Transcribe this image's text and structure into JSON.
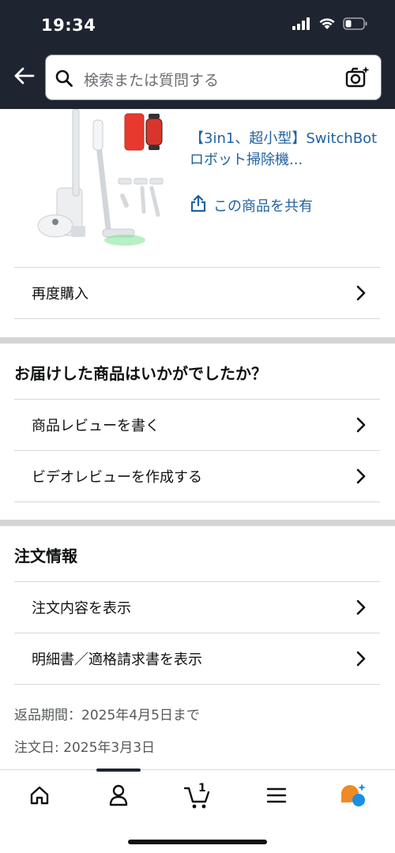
{
  "status_bar": {
    "time": "19:34"
  },
  "search": {
    "placeholder": "検索または質問する"
  },
  "product": {
    "title": "【3in1、超小型】SwitchBot ロボット掃除機...",
    "share_label": "この商品を共有"
  },
  "actions": {
    "buy_again": "再度購入"
  },
  "review_section": {
    "title": "お届けした商品はいかがでしたか？",
    "items": [
      {
        "label": "商品レビューを書く"
      },
      {
        "label": "ビデオレビューを作成する"
      }
    ]
  },
  "order_section": {
    "title": "注文情報",
    "items": [
      {
        "label": "注文内容を表示"
      },
      {
        "label": "明細書／適格請求書を表示"
      }
    ],
    "return_period": "返品期間：2025年4月5日まで",
    "order_date": "注文日: 2025年3月3日"
  },
  "bottom_nav": {
    "cart_count": "1",
    "items": [
      "home-icon",
      "account-icon",
      "cart-icon",
      "menu-icon",
      "ai-assistant-icon"
    ]
  },
  "colors": {
    "header_bg": "#1e2530",
    "link": "#2162a1",
    "assistant_orange": "#f08a24",
    "assistant_blue": "#1a8fe3"
  }
}
